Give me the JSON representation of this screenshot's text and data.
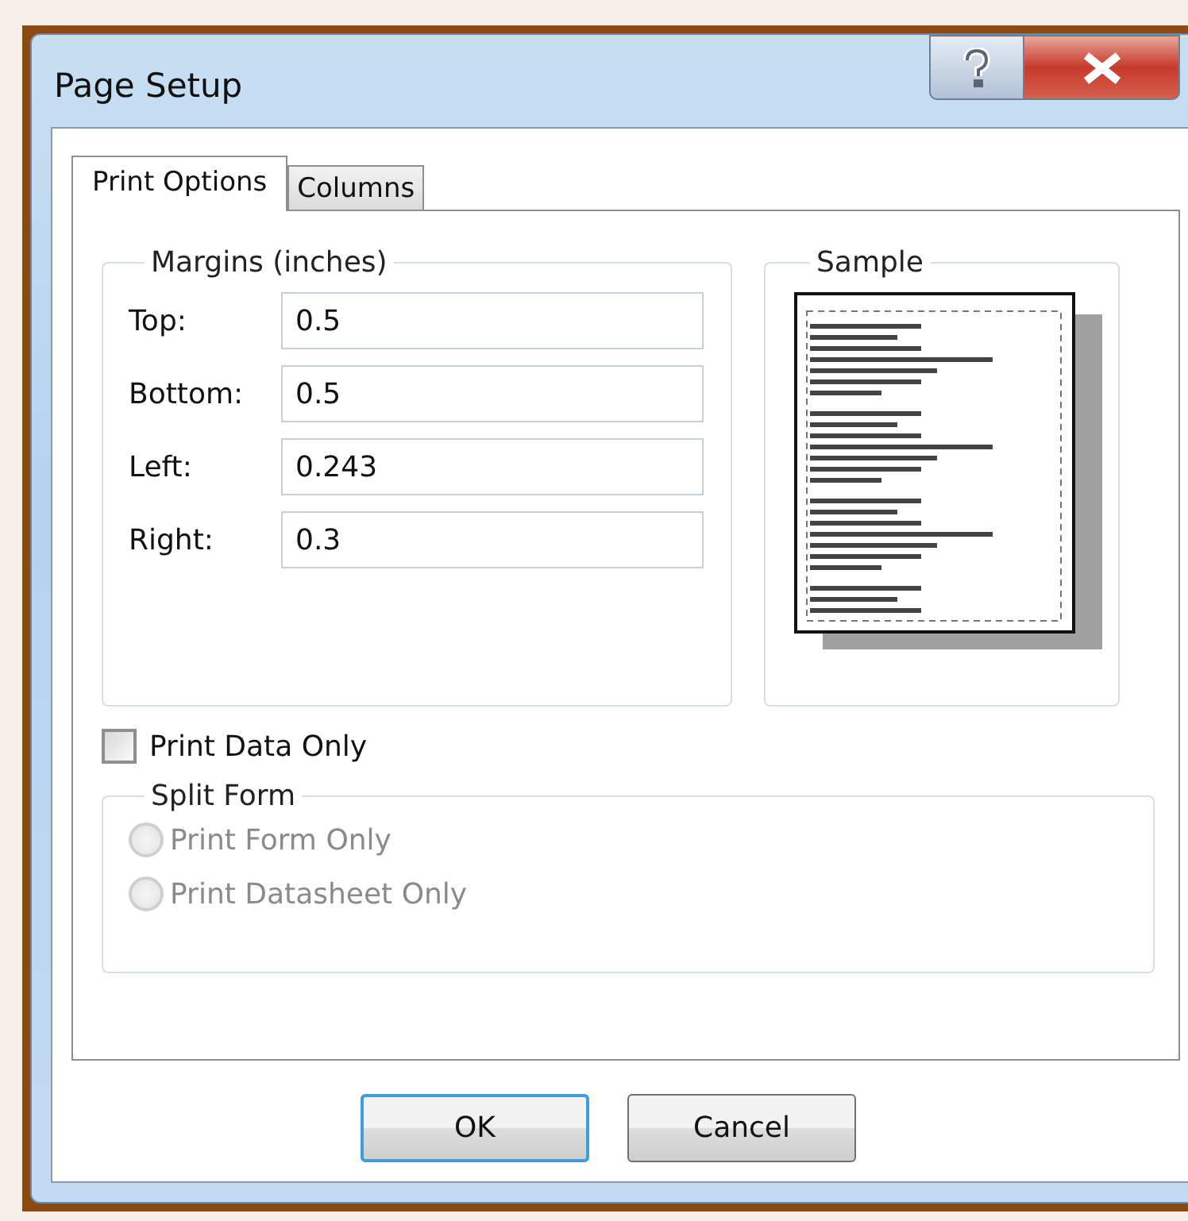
{
  "window": {
    "title": "Page Setup"
  },
  "tabs": [
    {
      "label": "Print Options",
      "selected": true
    },
    {
      "label": "Columns",
      "selected": false
    }
  ],
  "margins": {
    "title": "Margins (inches)",
    "fields": [
      {
        "label": "Top:",
        "value": "0.5"
      },
      {
        "label": "Bottom:",
        "value": "0.5"
      },
      {
        "label": "Left:",
        "value": "0.243"
      },
      {
        "label": "Right:",
        "value": "0.3"
      }
    ]
  },
  "sample": {
    "title": "Sample"
  },
  "print_data_only": {
    "label": "Print Data Only",
    "checked": false
  },
  "split_form": {
    "title": "Split Form",
    "options": [
      {
        "label": "Print Form Only",
        "selected": false,
        "disabled": true
      },
      {
        "label": "Print Datasheet Only",
        "selected": false,
        "disabled": true
      }
    ]
  },
  "buttons": [
    {
      "label": "OK",
      "default": true
    },
    {
      "label": "Cancel",
      "default": false
    }
  ]
}
